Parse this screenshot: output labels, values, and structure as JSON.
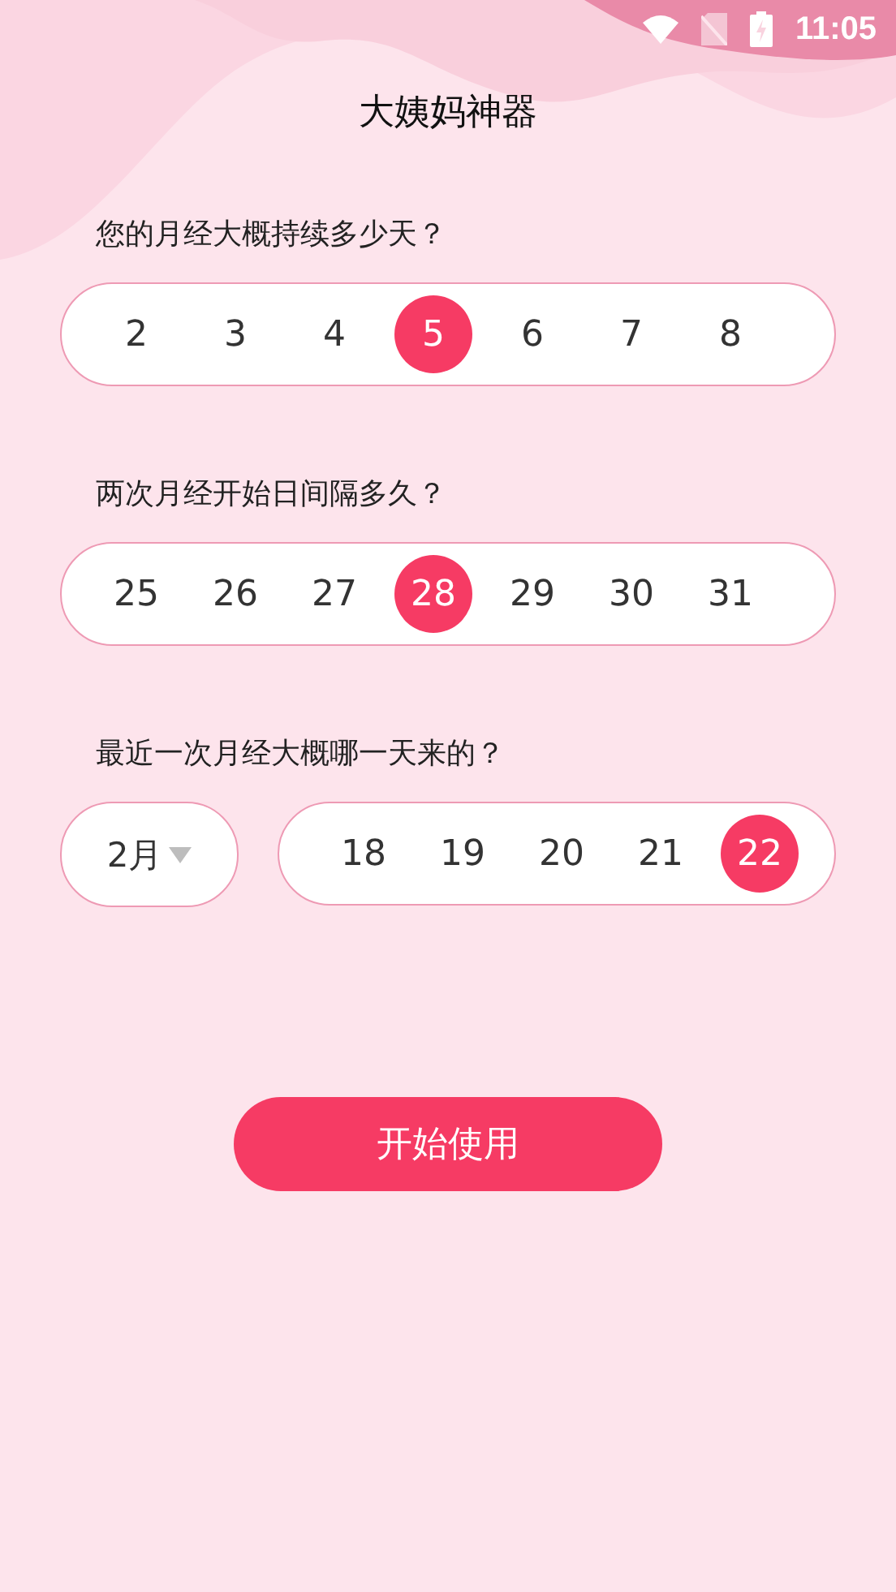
{
  "status_bar": {
    "time": "11:05"
  },
  "title": "大姨妈神器",
  "questions": [
    {
      "prompt": "您的月经大概持续多少天？",
      "options": [
        {
          "label": "2",
          "selected": false
        },
        {
          "label": "3",
          "selected": false
        },
        {
          "label": "4",
          "selected": false
        },
        {
          "label": "5",
          "selected": true
        },
        {
          "label": "6",
          "selected": false
        },
        {
          "label": "7",
          "selected": false
        },
        {
          "label": "8",
          "selected": false
        }
      ]
    },
    {
      "prompt": "两次月经开始日间隔多久？",
      "options": [
        {
          "label": "25",
          "selected": false
        },
        {
          "label": "26",
          "selected": false
        },
        {
          "label": "27",
          "selected": false
        },
        {
          "label": "28",
          "selected": true
        },
        {
          "label": "29",
          "selected": false
        },
        {
          "label": "30",
          "selected": false
        },
        {
          "label": "31",
          "selected": false
        }
      ]
    },
    {
      "prompt": "最近一次月经大概哪一天来的？",
      "month": {
        "value": "2月"
      },
      "options": [
        {
          "label": "18",
          "selected": false
        },
        {
          "label": "19",
          "selected": false
        },
        {
          "label": "20",
          "selected": false
        },
        {
          "label": "21",
          "selected": false
        },
        {
          "label": "22",
          "selected": true
        }
      ]
    }
  ],
  "start_button": "开始使用"
}
